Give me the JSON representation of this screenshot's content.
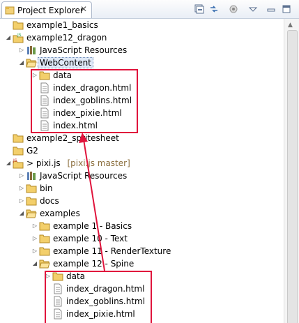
{
  "panel": {
    "title": "Project Explorer",
    "close_glyph": "✕",
    "toolbar": [
      "collapse-all-icon",
      "link-with-editor-icon",
      "focus-icon",
      "view-menu-icon",
      "minimize-icon",
      "maximize-icon"
    ]
  },
  "tree": [
    {
      "label": "example1_basics",
      "icon": "folder-icon",
      "twisty": "none",
      "level": 0
    },
    {
      "label": "example12_dragon",
      "icon": "js-project-icon",
      "twisty": "expanded",
      "level": 0
    },
    {
      "label": "JavaScript Resources",
      "icon": "library-icon",
      "twisty": "collapsed",
      "level": 1
    },
    {
      "label": "WebContent",
      "icon": "folder-open-icon",
      "twisty": "expanded",
      "level": 1,
      "selected": true
    },
    {
      "label": "data",
      "icon": "folder-icon",
      "twisty": "collapsed",
      "level": 2
    },
    {
      "label": "index_dragon.html",
      "icon": "html-file-icon",
      "twisty": "none",
      "level": 2
    },
    {
      "label": "index_goblins.html",
      "icon": "html-file-icon",
      "twisty": "none",
      "level": 2
    },
    {
      "label": "index_pixie.html",
      "icon": "html-file-icon",
      "twisty": "none",
      "level": 2
    },
    {
      "label": "index.html",
      "icon": "html-file-icon",
      "twisty": "none",
      "level": 2
    },
    {
      "label": "example2_spritesheet",
      "icon": "folder-icon",
      "twisty": "none",
      "level": 0
    },
    {
      "label": "G2",
      "icon": "folder-icon",
      "twisty": "none",
      "level": 0
    },
    {
      "label": "> pixi.js",
      "decoration": "[pixi.js master]",
      "icon": "git-project-icon",
      "twisty": "expanded",
      "level": 0
    },
    {
      "label": "JavaScript Resources",
      "icon": "library-icon",
      "twisty": "collapsed",
      "level": 1
    },
    {
      "label": "bin",
      "icon": "folder-icon",
      "twisty": "collapsed",
      "level": 1
    },
    {
      "label": "docs",
      "icon": "folder-icon",
      "twisty": "collapsed",
      "level": 1
    },
    {
      "label": "examples",
      "icon": "folder-open-icon",
      "twisty": "expanded",
      "level": 1
    },
    {
      "label": "example 1 - Basics",
      "icon": "folder-icon",
      "twisty": "collapsed",
      "level": 2
    },
    {
      "label": "example 10 - Text",
      "icon": "folder-icon",
      "twisty": "collapsed",
      "level": 2
    },
    {
      "label": "example 11 - RenderTexture",
      "icon": "folder-icon",
      "twisty": "collapsed",
      "level": 2
    },
    {
      "label": "example 12 - Spine",
      "icon": "folder-open-icon",
      "twisty": "expanded",
      "level": 2
    },
    {
      "label": "data",
      "icon": "folder-icon",
      "twisty": "collapsed",
      "level": 3
    },
    {
      "label": "index_dragon.html",
      "icon": "html-file-icon",
      "twisty": "none",
      "level": 3
    },
    {
      "label": "index_goblins.html",
      "icon": "html-file-icon",
      "twisty": "none",
      "level": 3
    },
    {
      "label": "index_pixie.html",
      "icon": "html-file-icon",
      "twisty": "none",
      "level": 3
    }
  ],
  "annotation_color": "#e0143c"
}
